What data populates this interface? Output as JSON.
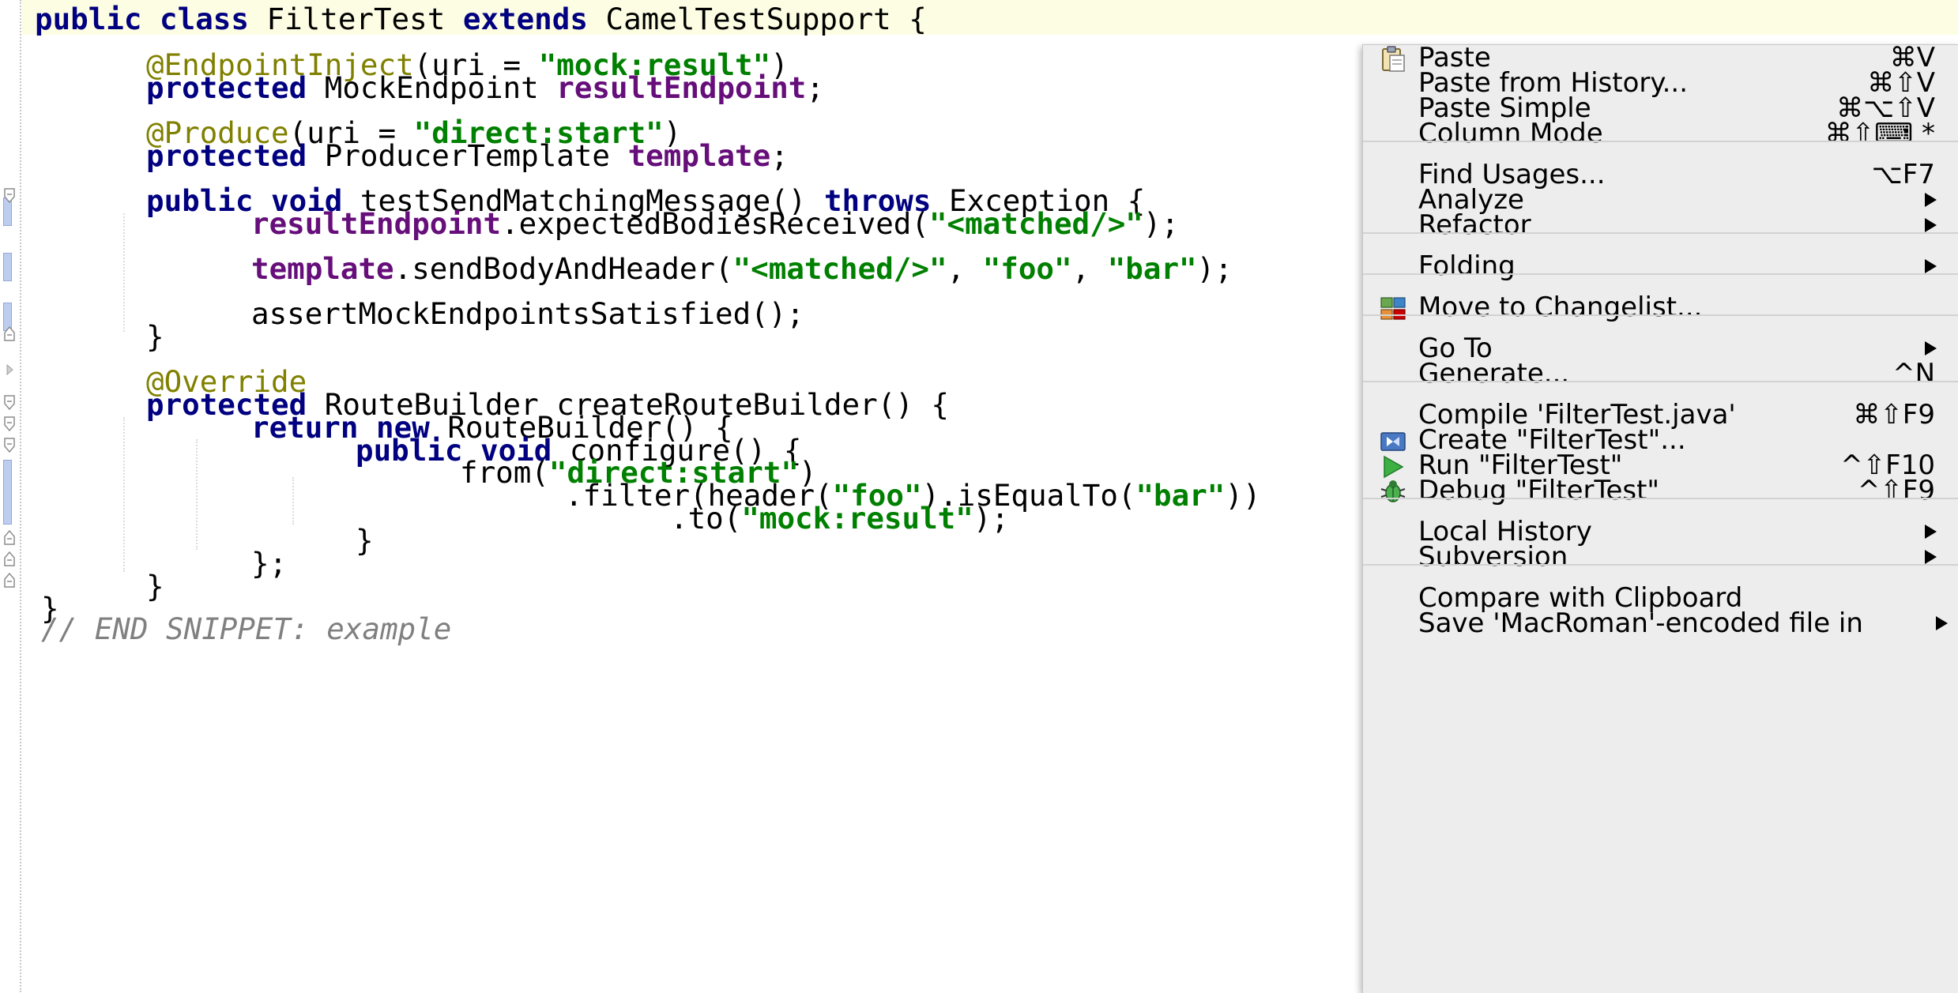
{
  "code": {
    "l1": {
      "kw1": "public class",
      "t1": " FilterTest ",
      "kw2": "extends",
      "t2": " CamelTestSupport {"
    },
    "l3": {
      "ann": "@EndpointInject",
      "t1": "(uri = ",
      "s1": "\"mock:result\"",
      "t2": ")"
    },
    "l4": {
      "kw": "protected",
      "t1": " MockEndpoint ",
      "f1": "resultEndpoint",
      "t2": ";"
    },
    "l6": {
      "ann": "@Produce",
      "t1": "(uri = ",
      "s1": "\"direct:start\"",
      "t2": ")"
    },
    "l7": {
      "kw": "protected",
      "t1": " ProducerTemplate ",
      "f1": "template",
      "t2": ";"
    },
    "l9": {
      "kw1": "public void",
      "t1": " testSendMatchingMessage() ",
      "kw2": "throws",
      "t2": " Exception {"
    },
    "l10": {
      "f1": "resultEndpoint",
      "t1": ".expectedBodiesReceived(",
      "s1": "\"<matched/>\"",
      "t2": ");"
    },
    "l12": {
      "f1": "template",
      "t1": ".sendBodyAndHeader(",
      "s1": "\"<matched/>\"",
      "t2": ", ",
      "s2": "\"foo\"",
      "t3": ", ",
      "s3": "\"bar\"",
      "t4": ");"
    },
    "l14": {
      "t1": "assertMockEndpointsSatisfied();"
    },
    "l15": {
      "t1": "}"
    },
    "l17": {
      "ann": "@Override"
    },
    "l18": {
      "kw": "protected",
      "t1": " RouteBuilder createRouteBuilder() {"
    },
    "l19": {
      "kw": "return new",
      "t1": " RouteBuilder() {"
    },
    "l20": {
      "kw": "public void",
      "t1": " configure() {"
    },
    "l21": {
      "t1": "from(",
      "s1": "\"direct:start\"",
      "t2": ")"
    },
    "l22": {
      "t1": ".filter(header(",
      "s1": "\"foo\"",
      "t2": ").isEqualTo(",
      "s2": "\"bar\"",
      "t3": "))"
    },
    "l23": {
      "t1": ".to(",
      "s1": "\"mock:result\"",
      "t2": ");"
    },
    "l24": {
      "t1": "}"
    },
    "l25": {
      "t1": "};"
    },
    "l26": {
      "t1": "}"
    },
    "l27": {
      "t1": "}"
    },
    "l28": {
      "c1": "// END SNIPPET: example"
    }
  },
  "menu": {
    "paste": {
      "label": "Paste",
      "shortcut": "⌘V",
      "icon": "clipboard-icon"
    },
    "paste_history": {
      "label": "Paste from History...",
      "shortcut": "⌘⇧V"
    },
    "paste_simple": {
      "label": "Paste Simple",
      "shortcut": "⌘⌥⇧V"
    },
    "column_mode": {
      "label": "Column Mode",
      "shortcut": "⌘⇧⌨ *"
    },
    "find_usages": {
      "label": "Find Usages...",
      "shortcut": "⌥F7"
    },
    "analyze": {
      "label": "Analyze"
    },
    "refactor": {
      "label": "Refactor"
    },
    "folding": {
      "label": "Folding"
    },
    "move_changelist": {
      "label": "Move to Changelist...",
      "icon": "changelist-icon"
    },
    "goto": {
      "label": "Go To"
    },
    "generate": {
      "label": "Generate...",
      "shortcut": "^N"
    },
    "compile": {
      "label": "Compile 'FilterTest.java'",
      "shortcut": "⌘⇧F9"
    },
    "create": {
      "label": "Create \"FilterTest\"...",
      "icon": "run-config-icon"
    },
    "run": {
      "label": "Run \"FilterTest\"",
      "shortcut": "^⇧F10",
      "icon": "run-icon"
    },
    "debug": {
      "label": "Debug \"FilterTest\"",
      "shortcut": "^⇧F9",
      "icon": "debug-icon"
    },
    "local_history": {
      "label": "Local History"
    },
    "subversion": {
      "label": "Subversion"
    },
    "compare_clipboard": {
      "label": "Compare with Clipboard"
    },
    "save_encoded": {
      "label": "Save 'MacRoman'-encoded file in"
    }
  }
}
